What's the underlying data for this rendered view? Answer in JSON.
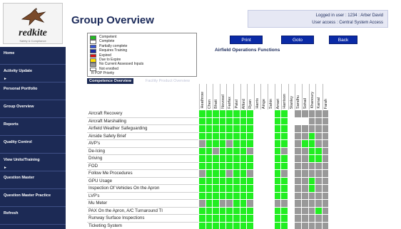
{
  "logo": {
    "brand": "redkite",
    "sub": "Safety & Compliance"
  },
  "sidebar": {
    "items": [
      {
        "label": "Home",
        "arrow": false
      },
      {
        "label": "Activity Update",
        "arrow": true
      },
      {
        "label": "Personal Portfolio",
        "arrow": false
      },
      {
        "label": "Group Overview",
        "arrow": false
      },
      {
        "label": "Reports",
        "arrow": false
      },
      {
        "label": "Quality Control",
        "arrow": false
      },
      {
        "label": "View Units/Training",
        "arrow": true
      },
      {
        "label": "Question Master",
        "arrow": false
      },
      {
        "label": "Question Master Practice",
        "arrow": false
      },
      {
        "label": "Refresh",
        "arrow": false
      }
    ]
  },
  "header": {
    "title": "Group Overview",
    "logged_in": "Logged in user :  1234 : Arber David",
    "access": "User access :  Central System Access"
  },
  "legend": [
    {
      "color": "#22bb22",
      "label": "Competent"
    },
    {
      "color": "#ffffff",
      "label": "Complete"
    },
    {
      "color": "#3355dd",
      "label": "Partially complete"
    },
    {
      "color": "#1a2aa0",
      "label": "Requires Training"
    },
    {
      "color": "#dd1111",
      "label": "Expired"
    },
    {
      "color": "#ffdd00",
      "label": "Due to Expire"
    },
    {
      "color": "#999999",
      "label": "No Current Assessed Inputs"
    },
    {
      "color": "#ffffff",
      "label": "Not enrolled"
    },
    {
      "color": "",
      "label": "R   PDP Priority"
    }
  ],
  "buttons": {
    "print": "Print",
    "goto": "Goto",
    "back": "Back"
  },
  "subtitle": "Airfield Operations Functions",
  "tabs": {
    "competence": "Competence Overview",
    "facility": "Facility Product Overview"
  },
  "columns": [
    "Heathrow",
    "Chen",
    "Bhatt",
    "Novosel",
    "Fairfax",
    "Patel",
    "Alford",
    "Ryan",
    "Harris",
    "Ainge",
    "Sahin",
    "Amari",
    "Harrison",
    "Stanley",
    "Sandhu",
    "Sohail",
    "Khanoury",
    "Kamal",
    "Farah"
  ],
  "colors": {
    "competent": "#22ee22",
    "none": "#999999",
    "empty": "#ffffff",
    "brand": "#1c2a55"
  },
  "rows": [
    {
      "label": "Aircraft Recovery",
      "cells": "GGGGGGGGWWWGGWSSSSS"
    },
    {
      "label": "Aircraft Marshalling",
      "cells": "GGGGGGGGWWWGGWWWSSS"
    },
    {
      "label": "Airfield Weather Safeguarding",
      "cells": "GGGGGGGGWWWGGWSSSSS"
    },
    {
      "label": "Airside Safety Brief",
      "cells": "GGGGGGGGWWWGGWSSGSS"
    },
    {
      "label": "AVP's",
      "cells": "SGGGSGGGWWWGGWSGGSS"
    },
    {
      "label": "De-Icing",
      "cells": "GGSGGGGSWWWGSWSSGGS"
    },
    {
      "label": "Driving",
      "cells": "GGGGGGGGWWWGGWSSGGS"
    },
    {
      "label": "FOD",
      "cells": "GGGGGGGGWWWGGWSSSSS"
    },
    {
      "label": "Follow Me Procedures",
      "cells": "SGGGSGGSWWWGSWSSSSS"
    },
    {
      "label": "GPU Usage",
      "cells": "GGGGGGGGWWWGGWSSGSS"
    },
    {
      "label": "Inspection Of Vehicles On the Apron",
      "cells": "GGGGGGGGWWWGGWSSGSS"
    },
    {
      "label": "LVP's",
      "cells": "GGGGGGGGWWWGGWSSSSS"
    },
    {
      "label": "Mu Meter",
      "cells": "SGGSSGGSWWWSSWSSSSS"
    },
    {
      "label": "PAX On the Apron, A/C Turnaround TI",
      "cells": "GGGGGGGGWWWGGWSSSGS"
    },
    {
      "label": "Runway Surface Inspections",
      "cells": "GGGGGGGGWWWGGWSSSSS"
    },
    {
      "label": "Ticketing System",
      "cells": "GGGGGGGGWWWGGWSSSSS"
    }
  ]
}
